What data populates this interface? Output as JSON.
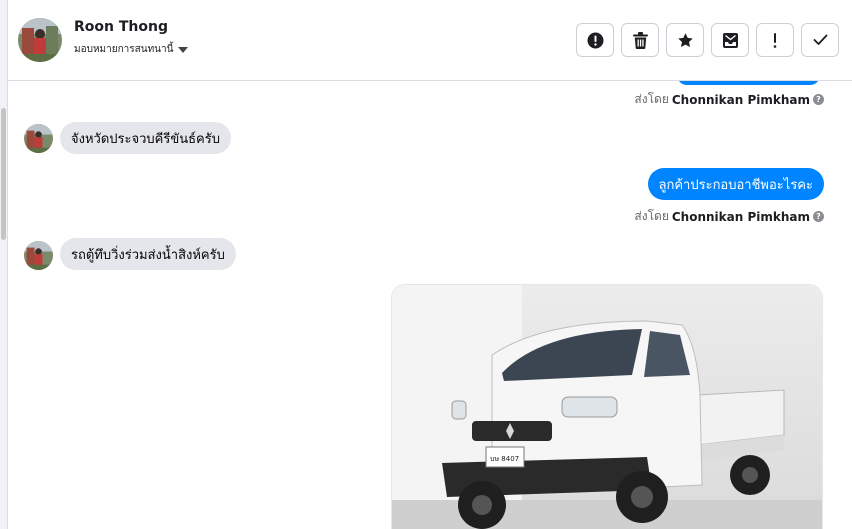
{
  "contact": {
    "name": "Roon Thong",
    "assign_label": "มอบหมายการสนทนานี้"
  },
  "toolbar": {
    "actions": [
      {
        "name": "spam-button",
        "icon": "alert-circle-icon"
      },
      {
        "name": "delete-button",
        "icon": "trash-icon"
      },
      {
        "name": "star-button",
        "icon": "star-icon"
      },
      {
        "name": "move-to-inbox-button",
        "icon": "inbox-icon"
      },
      {
        "name": "mark-important-button",
        "icon": "exclamation-icon"
      },
      {
        "name": "mark-done-button",
        "icon": "check-icon"
      }
    ]
  },
  "thread": {
    "sent_by_prefix": "ส่งโดย",
    "sent_by_name": "Chonnikan Pimkham",
    "messages": [
      {
        "direction": "in",
        "text": "จังหวัดประจวบคีรีขันธ์ครับ"
      },
      {
        "direction": "out",
        "text": "ลูกค้าประกอบอาชีพอะไรคะ"
      },
      {
        "direction": "in",
        "text": "รถตู้ทึบวิ่งร่วมส่งน้ำสิงห์ครับ"
      }
    ],
    "photo": {
      "plate": "บษ 8407"
    }
  },
  "colors": {
    "accent": "#0084ff",
    "incoming_bubble": "#e4e6eb",
    "border": "#ccd0d5"
  }
}
